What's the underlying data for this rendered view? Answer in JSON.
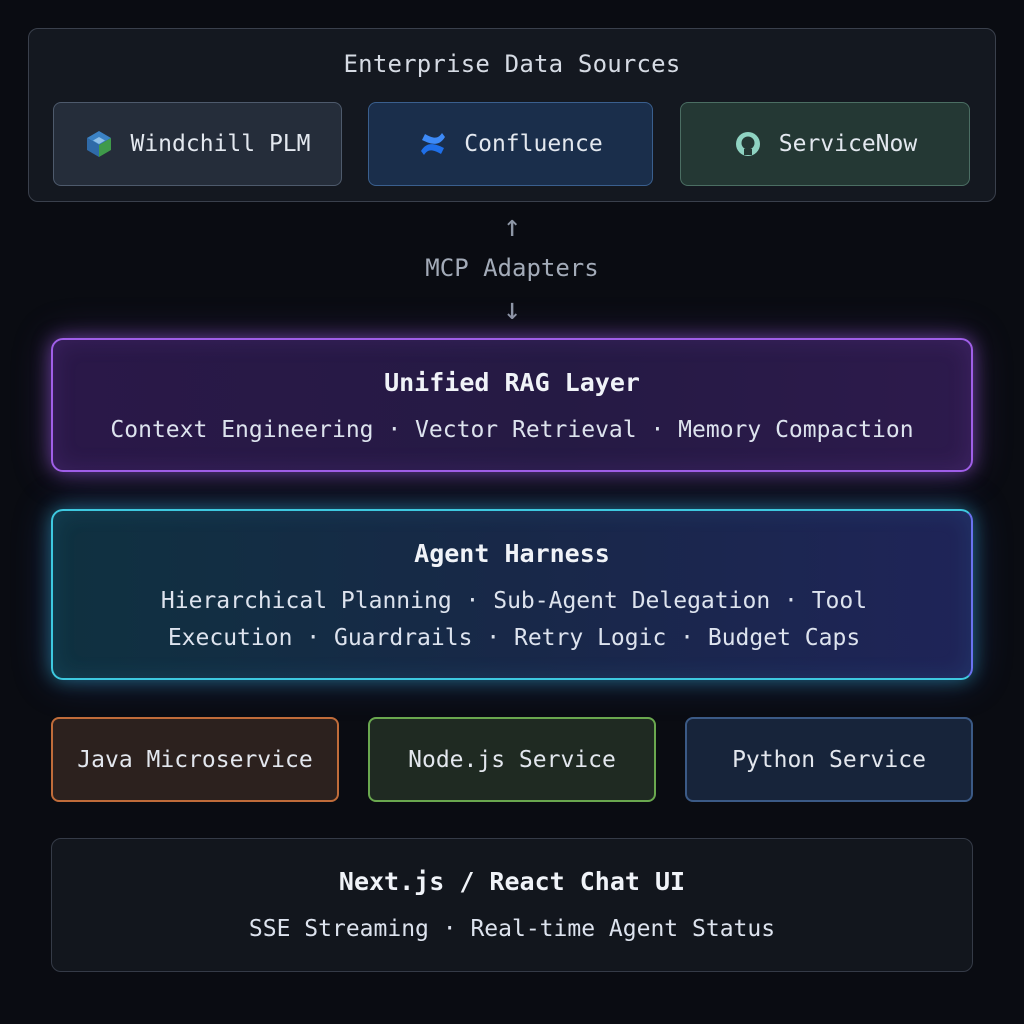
{
  "sources": {
    "title": "Enterprise Data Sources",
    "items": [
      {
        "label": "Windchill PLM",
        "icon": "windchill-cube-icon"
      },
      {
        "label": "Confluence",
        "icon": "confluence-logo-icon"
      },
      {
        "label": "ServiceNow",
        "icon": "servicenow-logo-icon"
      }
    ]
  },
  "connector": {
    "label": "MCP Adapters",
    "up_arrow": "↑",
    "down_arrow": "↓"
  },
  "rag_layer": {
    "title": "Unified RAG Layer",
    "description": "Context Engineering · Vector Retrieval · Memory Compaction"
  },
  "agent_harness": {
    "title": "Agent Harness",
    "description": "Hierarchical Planning · Sub-Agent Delegation · Tool Execution · Guardrails · Retry Logic · Budget Caps"
  },
  "services": [
    {
      "label": "Java Microservice",
      "color": "#c06c3a"
    },
    {
      "label": "Node.js Service",
      "color": "#6aa84f"
    },
    {
      "label": "Python Service",
      "color": "#3b5a86"
    }
  ],
  "frontend": {
    "title": "Next.js / React Chat UI",
    "description": "SSE Streaming · Real-time Agent Status"
  },
  "colors": {
    "background": "#0a0c12",
    "rag_border": "#a05fe8",
    "harness_border": "#3ec9e0"
  }
}
